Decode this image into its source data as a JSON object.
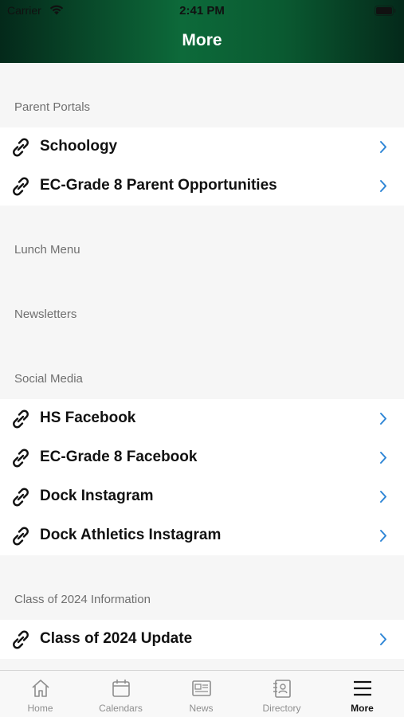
{
  "status_bar": {
    "carrier": "Carrier",
    "time": "2:41 PM"
  },
  "header": {
    "title": "More"
  },
  "sections": [
    {
      "title": "Parent Portals",
      "items": [
        "Schoology",
        "EC-Grade 8 Parent Opportunities"
      ]
    },
    {
      "title": "Lunch Menu",
      "items": []
    },
    {
      "title": "Newsletters",
      "items": []
    },
    {
      "title": "Social Media",
      "items": [
        "HS Facebook",
        "EC-Grade 8 Facebook",
        "Dock Instagram",
        "Dock Athletics Instagram"
      ]
    },
    {
      "title": "Class of 2024 Information",
      "items": [
        "Class of 2024 Update"
      ]
    }
  ],
  "tabbar": {
    "tabs": [
      {
        "label": "Home",
        "icon": "home-icon"
      },
      {
        "label": "Calendars",
        "icon": "calendar-icon"
      },
      {
        "label": "News",
        "icon": "newspaper-icon"
      },
      {
        "label": "Directory",
        "icon": "directory-icon"
      },
      {
        "label": "More",
        "icon": "menu-icon",
        "active": true
      }
    ]
  },
  "colors": {
    "accent": "#0d6a3a",
    "chevron": "#2f86d6"
  }
}
